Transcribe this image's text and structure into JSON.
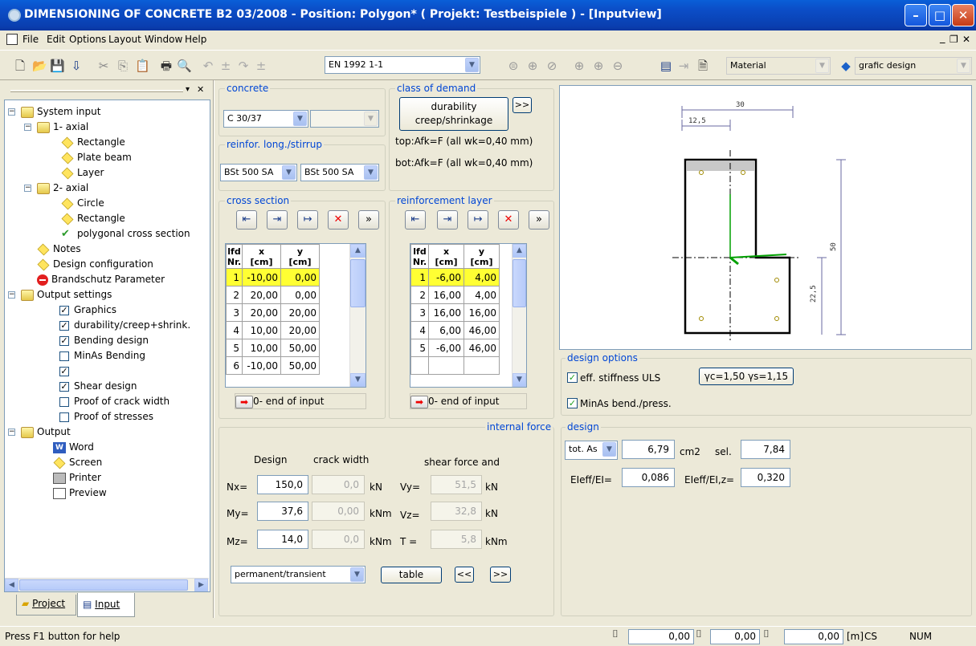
{
  "window": {
    "title": "DIMENSIONING OF CONCRETE B2 03/2008 - Position: Polygon* ( Projekt: Testbeispiele )  - [Inputview]"
  },
  "menu": [
    "File",
    "Edit",
    "Options",
    "Layout",
    "Window",
    "Help"
  ],
  "toolbar": {
    "norm": "EN 1992 1-1",
    "material": "Material",
    "view": "grafic design"
  },
  "tree": {
    "system_input": "System input",
    "axial1": "1- axial",
    "rectangle1": "Rectangle",
    "plate_beam": "Plate beam",
    "layer": "Layer",
    "axial2": "2- axial",
    "circle": "Circle",
    "rectangle2": "Rectangle",
    "polygonal": "polygonal cross section",
    "notes": "Notes",
    "design_config": "Design  configuration",
    "fire": "Brandschutz Parameter",
    "output_settings": "Output settings",
    "graphics": "Graphics",
    "durability": "durability/creep+shrink.",
    "bending": "Bending design",
    "minas": "MinAs Bending",
    "shear": "Shear design",
    "crack": "Proof of crack width",
    "stresses": "Proof of stresses",
    "output": "Output",
    "word": "Word",
    "screen": "Screen",
    "printer": "Printer",
    "preview": "Preview"
  },
  "tabs": {
    "project": "Project",
    "input": "Input"
  },
  "concrete": {
    "label": "concrete",
    "value": "C 30/37"
  },
  "reinf": {
    "label": "reinfor. long./stirrup",
    "long": "BSt 500 SA",
    "stirrup": "BSt 500 SA"
  },
  "demand": {
    "label": "class of demand",
    "button_line1": "durability",
    "button_line2": "creep/shrinkage",
    "more": ">>",
    "top": "top:Afk=F  (all wk=0,40 mm)",
    "bot": "bot:Afk=F  (all wk=0,40 mm)"
  },
  "cross_section": {
    "label": "cross section",
    "headers": [
      "lfd\nNr.",
      "x\n[cm]",
      "y\n[cm]"
    ],
    "rows": [
      [
        "1",
        "-10,00",
        "0,00"
      ],
      [
        "2",
        "20,00",
        "0,00"
      ],
      [
        "3",
        "20,00",
        "20,00"
      ],
      [
        "4",
        "10,00",
        "20,00"
      ],
      [
        "5",
        "10,00",
        "50,00"
      ],
      [
        "6",
        "-10,00",
        "50,00"
      ]
    ],
    "end": "0- end of input"
  },
  "reinf_layer": {
    "label": "reinforcement layer",
    "headers": [
      "lfd\nNr.",
      "x\n[cm]",
      "y\n[cm]"
    ],
    "rows": [
      [
        "1",
        "-6,00",
        "4,00"
      ],
      [
        "2",
        "16,00",
        "4,00"
      ],
      [
        "3",
        "16,00",
        "16,00"
      ],
      [
        "4",
        "6,00",
        "46,00"
      ],
      [
        "5",
        "-6,00",
        "46,00"
      ],
      [
        "",
        "",
        ""
      ]
    ],
    "end": "0- end of input"
  },
  "forces": {
    "label": "internal force",
    "design": "Design",
    "crack": "crack width",
    "shear": "shear force and",
    "nx_l": "Nx=",
    "my_l": "My=",
    "mz_l": "Mz=",
    "nx": "150,0",
    "my": "37,6",
    "mz": "14,0",
    "nx_c": "0,0",
    "my_c": "0,00",
    "mz_c": "0,0",
    "u1": "kN",
    "u2": "kNm",
    "u3": "kNm",
    "vy_l": "Vy=",
    "vz_l": "Vz=",
    "t_l": "T =",
    "vy": "51,5",
    "vz": "32,8",
    "t": "5,8",
    "u4": "kN",
    "u5": "kN",
    "u6": "kNm",
    "combo": "permanent/transient",
    "table": "table",
    "prev": "<<",
    "next": ">>"
  },
  "drawing": {
    "dim_top": "30",
    "dim_sub": "12,5",
    "dim_right": "50",
    "dim_lower": "22,5"
  },
  "design_options": {
    "label": "design options",
    "stiff": "eff. stiffness ULS",
    "gamma": "γc=1,50  γs=1,15",
    "minas": "MinAs bend./press."
  },
  "design": {
    "label": "design",
    "mode": "tot. As",
    "as": "6,79",
    "unit": "cm2",
    "sel_l": "sel.",
    "sel": "7,84",
    "ei_l": "EIeff/EI=",
    "ei": "0,086",
    "eiz_l": "EIeff/EI,z=",
    "eiz": "0,320"
  },
  "status": {
    "help": "Press F1 button for help",
    "x": "0,00",
    "y": "0,00",
    "z": "0,00",
    "unit": "[m]",
    "cs": "CS",
    "num": "NUM"
  }
}
